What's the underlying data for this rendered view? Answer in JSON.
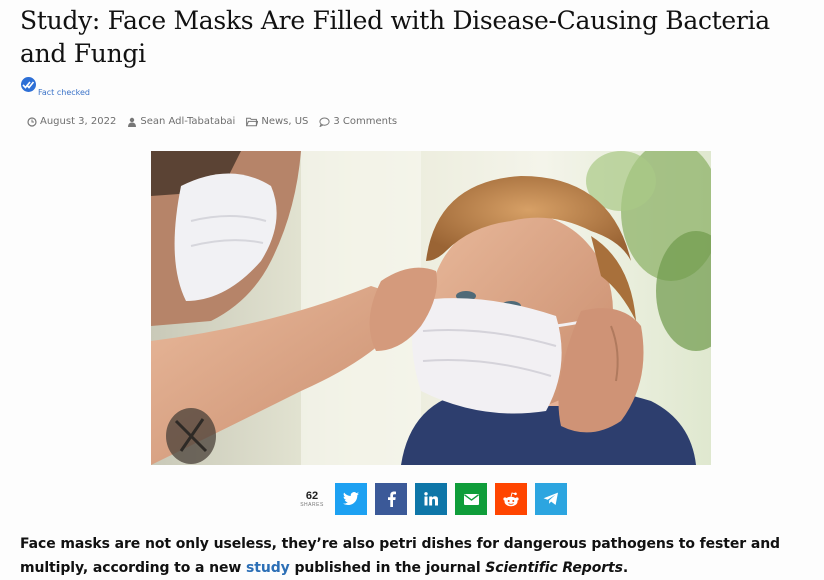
{
  "article": {
    "title": "Study: Face Masks Are Filled with Disease-Causing Bacteria and Fungi",
    "fact_label": "Fact checked",
    "meta": {
      "date": "August 3, 2022",
      "author": "Sean Adl-Tabatabai",
      "categories": "News, US",
      "comments": "3 Comments"
    },
    "hero_image": {
      "description": "Adult hand adjusting surgical face mask on child"
    },
    "share": {
      "count": "62",
      "count_label": "SHARES",
      "buttons": [
        {
          "name": "twitter",
          "icon": "twitter-icon",
          "color": "#1da1f2"
        },
        {
          "name": "facebook",
          "icon": "facebook-icon",
          "color": "#3b5998"
        },
        {
          "name": "linkedin",
          "icon": "linkedin-icon",
          "color": "#0e76a8"
        },
        {
          "name": "email",
          "icon": "email-icon",
          "color": "#0f9d3a"
        },
        {
          "name": "reddit",
          "icon": "reddit-icon",
          "color": "#ff4500"
        },
        {
          "name": "telegram",
          "icon": "telegram-icon",
          "color": "#2ca5e0"
        }
      ]
    },
    "body": {
      "text_1": "Face masks are not only useless, they’re also petri dishes for dangerous pathogens to fester and multiply, according to a new ",
      "link_text": "study",
      "text_2": " published in the journal ",
      "journal": "Scientific Reports",
      "text_3": "."
    }
  },
  "colors": {
    "link": "#2c6fb6",
    "meta": "#6f6f6f",
    "fact_badge": "#2d6fd6"
  }
}
